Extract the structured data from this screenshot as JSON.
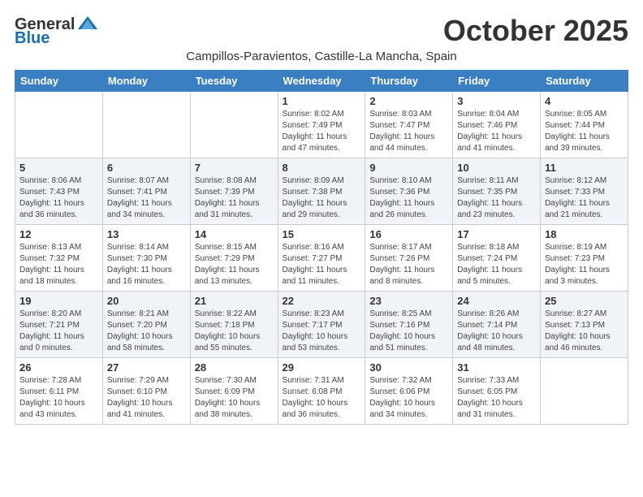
{
  "logo": {
    "general": "General",
    "blue": "Blue"
  },
  "header": {
    "month_year": "October 2025",
    "location": "Campillos-Paravientos, Castille-La Mancha, Spain"
  },
  "weekdays": [
    "Sunday",
    "Monday",
    "Tuesday",
    "Wednesday",
    "Thursday",
    "Friday",
    "Saturday"
  ],
  "weeks": [
    [
      {
        "day": "",
        "info": ""
      },
      {
        "day": "",
        "info": ""
      },
      {
        "day": "",
        "info": ""
      },
      {
        "day": "1",
        "info": "Sunrise: 8:02 AM\nSunset: 7:49 PM\nDaylight: 11 hours and 47 minutes."
      },
      {
        "day": "2",
        "info": "Sunrise: 8:03 AM\nSunset: 7:47 PM\nDaylight: 11 hours and 44 minutes."
      },
      {
        "day": "3",
        "info": "Sunrise: 8:04 AM\nSunset: 7:46 PM\nDaylight: 11 hours and 41 minutes."
      },
      {
        "day": "4",
        "info": "Sunrise: 8:05 AM\nSunset: 7:44 PM\nDaylight: 11 hours and 39 minutes."
      }
    ],
    [
      {
        "day": "5",
        "info": "Sunrise: 8:06 AM\nSunset: 7:43 PM\nDaylight: 11 hours and 36 minutes."
      },
      {
        "day": "6",
        "info": "Sunrise: 8:07 AM\nSunset: 7:41 PM\nDaylight: 11 hours and 34 minutes."
      },
      {
        "day": "7",
        "info": "Sunrise: 8:08 AM\nSunset: 7:39 PM\nDaylight: 11 hours and 31 minutes."
      },
      {
        "day": "8",
        "info": "Sunrise: 8:09 AM\nSunset: 7:38 PM\nDaylight: 11 hours and 29 minutes."
      },
      {
        "day": "9",
        "info": "Sunrise: 8:10 AM\nSunset: 7:36 PM\nDaylight: 11 hours and 26 minutes."
      },
      {
        "day": "10",
        "info": "Sunrise: 8:11 AM\nSunset: 7:35 PM\nDaylight: 11 hours and 23 minutes."
      },
      {
        "day": "11",
        "info": "Sunrise: 8:12 AM\nSunset: 7:33 PM\nDaylight: 11 hours and 21 minutes."
      }
    ],
    [
      {
        "day": "12",
        "info": "Sunrise: 8:13 AM\nSunset: 7:32 PM\nDaylight: 11 hours and 18 minutes."
      },
      {
        "day": "13",
        "info": "Sunrise: 8:14 AM\nSunset: 7:30 PM\nDaylight: 11 hours and 16 minutes."
      },
      {
        "day": "14",
        "info": "Sunrise: 8:15 AM\nSunset: 7:29 PM\nDaylight: 11 hours and 13 minutes."
      },
      {
        "day": "15",
        "info": "Sunrise: 8:16 AM\nSunset: 7:27 PM\nDaylight: 11 hours and 11 minutes."
      },
      {
        "day": "16",
        "info": "Sunrise: 8:17 AM\nSunset: 7:26 PM\nDaylight: 11 hours and 8 minutes."
      },
      {
        "day": "17",
        "info": "Sunrise: 8:18 AM\nSunset: 7:24 PM\nDaylight: 11 hours and 5 minutes."
      },
      {
        "day": "18",
        "info": "Sunrise: 8:19 AM\nSunset: 7:23 PM\nDaylight: 11 hours and 3 minutes."
      }
    ],
    [
      {
        "day": "19",
        "info": "Sunrise: 8:20 AM\nSunset: 7:21 PM\nDaylight: 11 hours and 0 minutes."
      },
      {
        "day": "20",
        "info": "Sunrise: 8:21 AM\nSunset: 7:20 PM\nDaylight: 10 hours and 58 minutes."
      },
      {
        "day": "21",
        "info": "Sunrise: 8:22 AM\nSunset: 7:18 PM\nDaylight: 10 hours and 55 minutes."
      },
      {
        "day": "22",
        "info": "Sunrise: 8:23 AM\nSunset: 7:17 PM\nDaylight: 10 hours and 53 minutes."
      },
      {
        "day": "23",
        "info": "Sunrise: 8:25 AM\nSunset: 7:16 PM\nDaylight: 10 hours and 51 minutes."
      },
      {
        "day": "24",
        "info": "Sunrise: 8:26 AM\nSunset: 7:14 PM\nDaylight: 10 hours and 48 minutes."
      },
      {
        "day": "25",
        "info": "Sunrise: 8:27 AM\nSunset: 7:13 PM\nDaylight: 10 hours and 46 minutes."
      }
    ],
    [
      {
        "day": "26",
        "info": "Sunrise: 7:28 AM\nSunset: 6:11 PM\nDaylight: 10 hours and 43 minutes."
      },
      {
        "day": "27",
        "info": "Sunrise: 7:29 AM\nSunset: 6:10 PM\nDaylight: 10 hours and 41 minutes."
      },
      {
        "day": "28",
        "info": "Sunrise: 7:30 AM\nSunset: 6:09 PM\nDaylight: 10 hours and 38 minutes."
      },
      {
        "day": "29",
        "info": "Sunrise: 7:31 AM\nSunset: 6:08 PM\nDaylight: 10 hours and 36 minutes."
      },
      {
        "day": "30",
        "info": "Sunrise: 7:32 AM\nSunset: 6:06 PM\nDaylight: 10 hours and 34 minutes."
      },
      {
        "day": "31",
        "info": "Sunrise: 7:33 AM\nSunset: 6:05 PM\nDaylight: 10 hours and 31 minutes."
      },
      {
        "day": "",
        "info": ""
      }
    ]
  ]
}
